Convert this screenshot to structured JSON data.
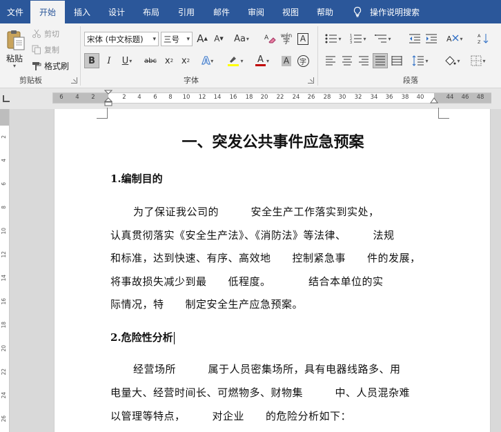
{
  "menu": {
    "tabs": [
      "文件",
      "开始",
      "插入",
      "设计",
      "布局",
      "引用",
      "邮件",
      "审阅",
      "视图",
      "帮助"
    ],
    "active": "开始",
    "search_label": "操作说明搜索"
  },
  "clipboard": {
    "paste": "粘贴",
    "cut": "剪切",
    "copy": "复制",
    "format_painter": "格式刷",
    "group_label": "剪贴板"
  },
  "font": {
    "name": "宋体 (中文标题)",
    "size": "三号",
    "group_label": "字体",
    "size_up": "A",
    "size_down": "A",
    "change_case": "Aa",
    "phonetic": "wén",
    "border_char": "A",
    "bold": "B",
    "italic": "I",
    "underline": "U",
    "strike": "abc",
    "subscript": "x",
    "superscript": "x",
    "shading_char": "A",
    "enclose_char": "字"
  },
  "paragraph": {
    "group_label": "段落"
  },
  "ruler": {
    "ticks": [
      "6",
      "4",
      "2",
      "2",
      "4",
      "6",
      "8",
      "10",
      "12",
      "14",
      "16",
      "18",
      "20",
      "22",
      "24",
      "26",
      "28",
      "30",
      "32",
      "34",
      "36",
      "38",
      "40",
      "44",
      "46",
      "48"
    ],
    "vticks": [
      "2",
      "4",
      "6",
      "8",
      "10",
      "12",
      "14",
      "16",
      "18",
      "20",
      "22",
      "24",
      "26"
    ]
  },
  "document": {
    "title": "一、突发公共事件应急预案",
    "h1": "1.编制目的",
    "p1": [
      "为了保证我公司的　　　安全生产工作落实到实处，",
      "认真贯彻落实《安全生产法》、《消防法》等法律、　　　法规",
      "和标准，达到快速、有序、高效地　　控制紧急事　　件的发展，",
      "将事故损失减少到最　　低程度。　　　　结合本单位的实",
      "际情况，特　　制定安全生产应急预案。"
    ],
    "h2": "2.危险性分析",
    "p2": [
      "经营场所　　　属于人员密集场所，具有电器线路多、用",
      "电量大、经营时间长、可燃物多、财物集　　　中、人员混杂难",
      "以管理等特点，　　　对企业　　的危险分析如下："
    ]
  },
  "colors": {
    "brand": "#2b579a",
    "font_color": "#c00000",
    "highlight": "#ffff00"
  }
}
